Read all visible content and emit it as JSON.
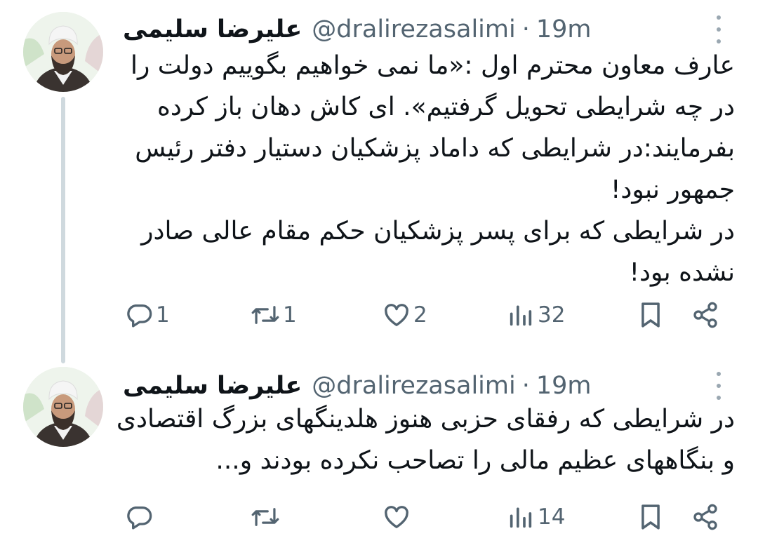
{
  "tweets": [
    {
      "display_name": "علیرضا سلیمی",
      "handle": "@dralirezasalimi",
      "separator": "·",
      "time": "19m",
      "lines": [
        "عارف معاون محترم اول :«ما نمی خواهیم بگوییم دولت را",
        "در چه شرایطی تحویل گرفتیم». ای کاش دهان باز کرده",
        "بفرمایند:در شرایطی که داماد پزشکیان دستیار دفتر رئیس",
        "جمهور نبود!",
        "در شرایطی که برای پسر پزشکیان حکم مقام عالی صادر",
        "نشده بود!"
      ],
      "replies": "1",
      "retweets": "1",
      "likes": "2",
      "views": "32"
    },
    {
      "display_name": "علیرضا سلیمی",
      "handle": "@dralirezasalimi",
      "separator": "·",
      "time": "19m",
      "lines": [
        "در شرایطی که رفقای حزبی هنوز هلدینگهای بزرگ اقتصادی",
        "و بنگاههای عظیم مالی را تصاحب نکرده بودند و..."
      ],
      "replies": "",
      "retweets": "",
      "likes": "",
      "views": "14"
    }
  ],
  "icons": {
    "reply": "reply-icon",
    "retweet": "retweet-icon",
    "like": "heart-icon",
    "views": "views-chart-icon",
    "bookmark": "bookmark-icon",
    "share": "share-icon",
    "more": "more-vertical-icon"
  },
  "colors": {
    "text": "#0f1419",
    "secondary": "#536471",
    "thread_line": "#cfd9de"
  }
}
